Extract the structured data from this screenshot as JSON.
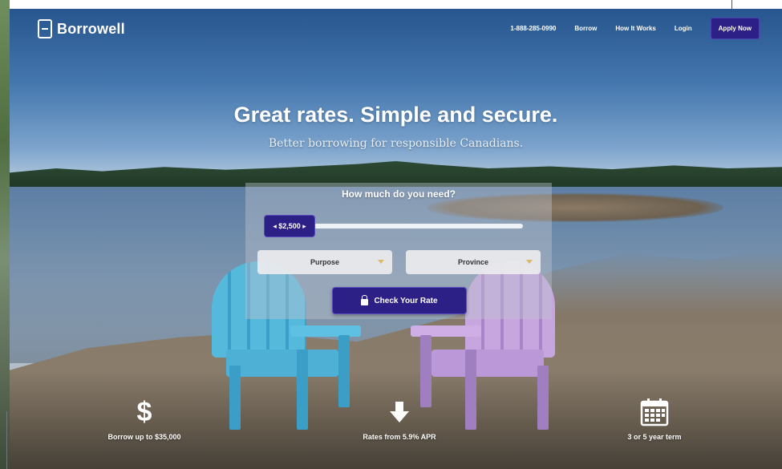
{
  "nav": {
    "logo": "Borrowell",
    "phone": "1-888-285-0990",
    "links": [
      "Borrow",
      "How It Works",
      "Login"
    ],
    "apply_label": "Apply Now"
  },
  "hero": {
    "headline": "Great rates. Simple and secure.",
    "subline": "Better borrowing for responsible Canadians."
  },
  "form": {
    "title": "How much do you need?",
    "amount": "$2,500",
    "purpose_label": "Purpose",
    "province_label": "Province",
    "check_label": "Check Your Rate"
  },
  "features": [
    {
      "label": "Borrow up to $35,000",
      "icon": "dollar-icon"
    },
    {
      "label": "Rates from 5.9% APR",
      "icon": "down-arrow-icon"
    },
    {
      "label": "3 or 5 year term",
      "icon": "calendar-icon"
    }
  ],
  "colors": {
    "brand_button": "#2c1f86",
    "select_caret": "#d8b86a"
  }
}
